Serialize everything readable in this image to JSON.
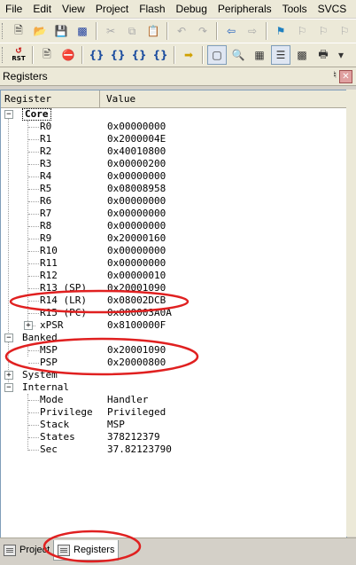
{
  "menu": [
    "File",
    "Edit",
    "View",
    "Project",
    "Flash",
    "Debug",
    "Peripherals",
    "Tools",
    "SVCS"
  ],
  "panel": {
    "title": "Registers",
    "pin_icon": "pin-icon",
    "close_icon": "close-icon"
  },
  "columns": {
    "register": "Register",
    "value": "Value"
  },
  "groups": {
    "core": "Core",
    "banked": "Banked",
    "system": "System",
    "internal": "Internal"
  },
  "core_regs": [
    {
      "name": "R0",
      "value": "0x00000000"
    },
    {
      "name": "R1",
      "value": "0x2000004E"
    },
    {
      "name": "R2",
      "value": "0x40010800"
    },
    {
      "name": "R3",
      "value": "0x00000200"
    },
    {
      "name": "R4",
      "value": "0x00000000"
    },
    {
      "name": "R5",
      "value": "0x08008958"
    },
    {
      "name": "R6",
      "value": "0x00000000"
    },
    {
      "name": "R7",
      "value": "0x00000000"
    },
    {
      "name": "R8",
      "value": "0x00000000"
    },
    {
      "name": "R9",
      "value": "0x20000160"
    },
    {
      "name": "R10",
      "value": "0x00000000"
    },
    {
      "name": "R11",
      "value": "0x00000000"
    },
    {
      "name": "R12",
      "value": "0x00000010"
    },
    {
      "name": "R13 (SP)",
      "value": "0x20001090"
    },
    {
      "name": "R14 (LR)",
      "value": "0x08002DCB"
    },
    {
      "name": "R15 (PC)",
      "value": "0x080003A0A"
    },
    {
      "name": "xPSR",
      "value": "0x8100000F"
    }
  ],
  "banked_regs": [
    {
      "name": "MSP",
      "value": "0x20001090"
    },
    {
      "name": "PSP",
      "value": "0x20000800"
    }
  ],
  "internal_regs": [
    {
      "name": "Mode",
      "value": "Handler"
    },
    {
      "name": "Privilege",
      "value": "Privileged"
    },
    {
      "name": "Stack",
      "value": "MSP"
    },
    {
      "name": "States",
      "value": "378212379"
    },
    {
      "name": "Sec",
      "value": "37.82123790"
    }
  ],
  "tabs": [
    {
      "label": "Project",
      "active": false
    },
    {
      "label": "Registers",
      "active": true
    }
  ],
  "toolbar2": {
    "rst_label": "RST"
  },
  "annotation_color": "#e02020"
}
